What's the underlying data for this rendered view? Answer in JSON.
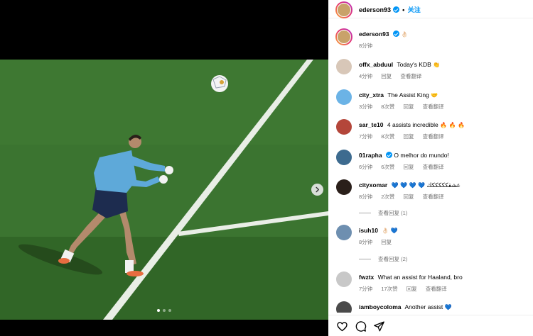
{
  "post": {
    "author": "ederson93",
    "follow_separator": "•",
    "follow_label": "关注",
    "caption_author": "ederson93",
    "caption_emoji": "👌🏻",
    "caption_time": "8分钟"
  },
  "carousel": {
    "total_slides": 3,
    "active_slide": 1,
    "next_icon": "chevron-right-icon"
  },
  "labels": {
    "reply": "回复",
    "translate": "查看翻译"
  },
  "comments": [
    {
      "user": "offx_abduul",
      "text": "Today's KDB",
      "emoji": "👏",
      "time": "4分钟",
      "likes": "",
      "avatar_color": "#d8c7b8"
    },
    {
      "user": "city_xtra",
      "text": "The Assist King",
      "emoji": "🤝",
      "time": "3分钟",
      "likes": "8次赞",
      "avatar_color": "#6bb3e6"
    },
    {
      "user": "sar_te10",
      "text": "4 assists incredible",
      "emoji": "🔥 🔥 🔥",
      "time": "7分钟",
      "likes": "8次赞",
      "avatar_color": "#b4463a"
    },
    {
      "user": "01rapha",
      "text": "O melhor do mundo!",
      "emoji": "",
      "time": "6分钟",
      "likes": "6次赞",
      "avatar_color": "#3d6b8f",
      "verified": true
    },
    {
      "user": "cityxomar",
      "text": "عشقكككككك",
      "emoji": "💙 💙 💙 💙",
      "time": "8分钟",
      "likes": "2次赞",
      "avatar_color": "#2a1f1a"
    },
    {
      "user": "isuh10",
      "text": "",
      "emoji": "👌🏻 💙",
      "time": "8分钟",
      "likes": "",
      "avatar_color": "#6e8fb0"
    },
    {
      "user": "fwztx",
      "text": "What an assist for Haaland, bro",
      "emoji": "",
      "time": "7分钟",
      "likes": "17次赞",
      "avatar_color": "#c8c8c8"
    },
    {
      "user": "iamboycoloma",
      "text": "Another assist",
      "emoji": "💙",
      "time": "",
      "likes": "",
      "avatar_color": "#4a4a4a"
    }
  ],
  "view_replies": [
    {
      "label": "查看回复 (1)"
    },
    {
      "label": "查看回复 (2)"
    }
  ],
  "action_icons": [
    "heart-icon",
    "comment-icon",
    "share-icon"
  ],
  "colors": {
    "accent": "#0095f6",
    "muted": "#737373",
    "pitch": "#3a7230"
  }
}
